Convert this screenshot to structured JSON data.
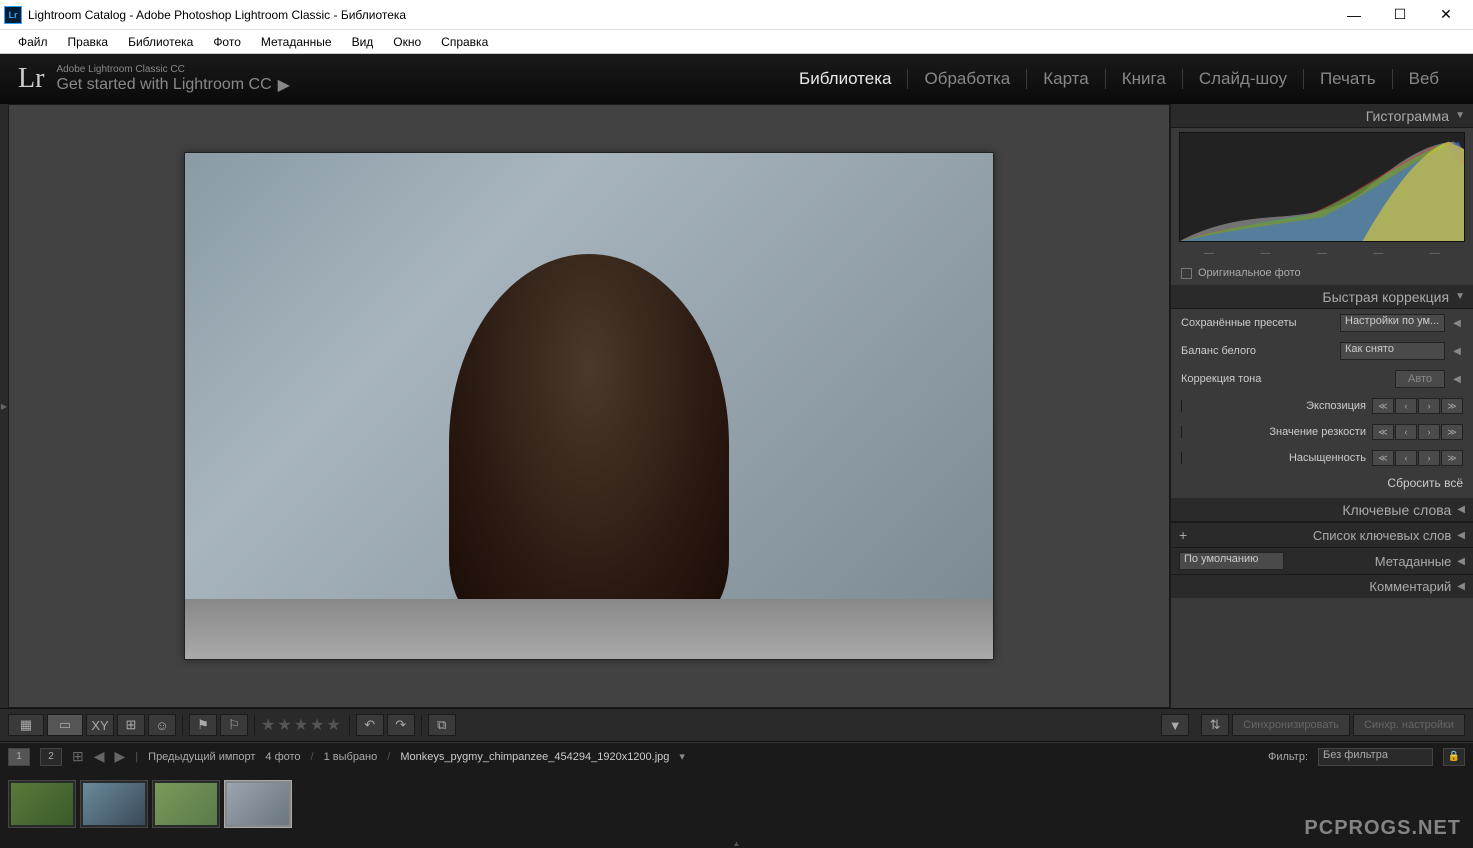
{
  "window": {
    "title": "Lightroom Catalog - Adobe Photoshop Lightroom Classic - Библиотека",
    "lr_badge": "Lr"
  },
  "menu": [
    "Файл",
    "Правка",
    "Библиотека",
    "Фото",
    "Метаданные",
    "Вид",
    "Окно",
    "Справка"
  ],
  "identity": {
    "logo": "Lr",
    "line1": "Adobe Lightroom Classic CC",
    "line2": "Get started with Lightroom CC"
  },
  "modules": [
    {
      "label": "Библиотека",
      "active": true
    },
    {
      "label": "Обработка",
      "active": false
    },
    {
      "label": "Карта",
      "active": false
    },
    {
      "label": "Книга",
      "active": false
    },
    {
      "label": "Слайд-шоу",
      "active": false
    },
    {
      "label": "Печать",
      "active": false
    },
    {
      "label": "Веб",
      "active": false
    }
  ],
  "panels": {
    "histogram": {
      "title": "Гистограмма",
      "orig_photo": "Оригинальное фото"
    },
    "quick_dev": {
      "title": "Быстрая коррекция",
      "saved_preset_lbl": "Сохранённые пресеты",
      "saved_preset_val": "Настройки по ум...",
      "wb_lbl": "Баланс белого",
      "wb_val": "Как снято",
      "tone_lbl": "Коррекция тона",
      "auto": "Авто",
      "exposure": "Экспозиция",
      "clarity": "Значение резкости",
      "saturation": "Насыщенность",
      "reset": "Сбросить всё"
    },
    "keywords": {
      "title": "Ключевые слова"
    },
    "keyword_list": {
      "title": "Список ключевых слов"
    },
    "metadata": {
      "title": "Метаданные",
      "preset": "По умолчанию"
    },
    "comments": {
      "title": "Комментарий"
    }
  },
  "sync": {
    "sync": "Синхронизировать",
    "sync_settings": "Синхр. настройки"
  },
  "filmstrip": {
    "prev_import": "Предыдущий импорт",
    "count": "4 фото",
    "selected": "1 выбрано",
    "filename": "Monkeys_pygmy_chimpanzee_454294_1920x1200.jpg",
    "filter_lbl": "Фильтр:",
    "filter_val": "Без фильтра"
  },
  "watermark": "PCPROGS.NET"
}
